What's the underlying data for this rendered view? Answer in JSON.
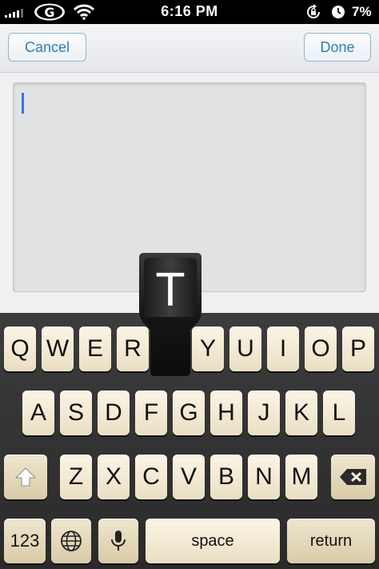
{
  "status_bar": {
    "time": "6:16 PM",
    "battery": "7%",
    "carrier_logo_letter": "G",
    "icons": [
      "signal-icon",
      "carrier-logo",
      "wifi-icon",
      "rotation-lock-icon",
      "alarm-icon"
    ]
  },
  "nav": {
    "cancel_label": "Cancel",
    "done_label": "Done"
  },
  "editor": {
    "value": ""
  },
  "keyboard": {
    "row1": [
      "Q",
      "W",
      "E",
      "R",
      "T",
      "Y",
      "U",
      "I",
      "O",
      "P"
    ],
    "row2": [
      "A",
      "S",
      "D",
      "F",
      "G",
      "H",
      "J",
      "K",
      "L"
    ],
    "row3": [
      "Z",
      "X",
      "C",
      "V",
      "B",
      "N",
      "M"
    ],
    "numbers_label": "123",
    "space_label": "space",
    "return_label": "return",
    "pressed_key": "T"
  },
  "colors": {
    "accent": "#2f7db8",
    "caret": "#3f6fe6",
    "key_face": "#f5eed9",
    "keyboard_bg": "#333333"
  }
}
